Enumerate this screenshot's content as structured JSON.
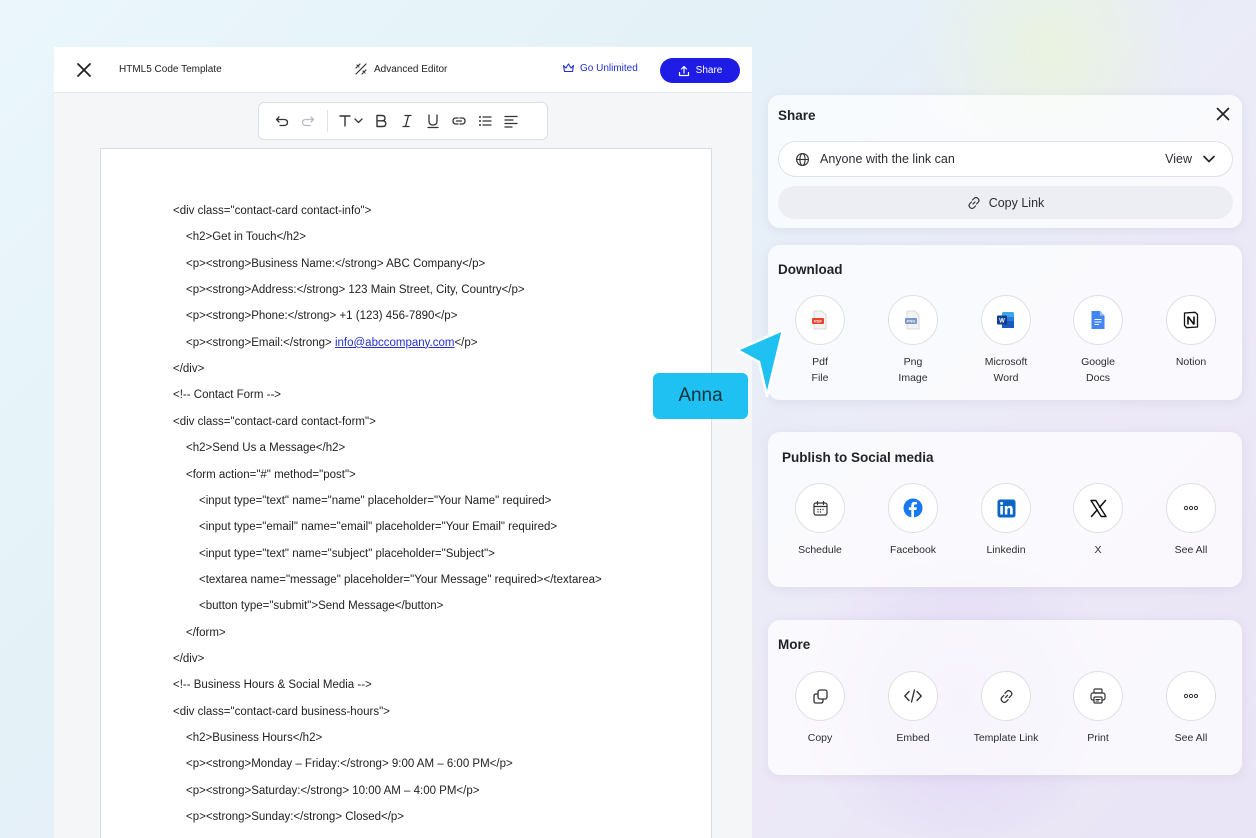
{
  "editor": {
    "doc_title": "HTML5 Code Template",
    "advanced_editor": "Advanced Editor",
    "go_unlimited": "Go Unlimited",
    "share": "Share"
  },
  "code_lines": [
    {
      "indent": 0,
      "text": "<div class=\"contact-card contact-info\">"
    },
    {
      "indent": 1,
      "text": "<h2>Get in Touch</h2>"
    },
    {
      "indent": 1,
      "text": "<p><strong>Business Name:</strong> ABC Company</p>"
    },
    {
      "indent": 1,
      "text": "<p><strong>Address:</strong> 123 Main Street, City, Country</p>"
    },
    {
      "indent": 1,
      "text": "<p><strong>Phone:</strong> +1 (123) 456-7890</p>"
    },
    {
      "indent": 1,
      "text": "<p><strong>Email:</strong> ",
      "link": "info@abccompany.com",
      "after": "</p>"
    },
    {
      "indent": 0,
      "text": "</div>"
    },
    {
      "indent": 0,
      "text": "<!-- Contact Form -->"
    },
    {
      "indent": 0,
      "text": "<div class=\"contact-card contact-form\">"
    },
    {
      "indent": 1,
      "text": "<h2>Send Us a Message</h2>"
    },
    {
      "indent": 1,
      "text": "<form action=\"#\" method=\"post\">"
    },
    {
      "indent": 2,
      "text": "<input type=\"text\" name=\"name\" placeholder=\"Your Name\" required>"
    },
    {
      "indent": 2,
      "text": "<input type=\"email\" name=\"email\" placeholder=\"Your Email\" required>"
    },
    {
      "indent": 2,
      "text": "<input type=\"text\" name=\"subject\" placeholder=\"Subject\">"
    },
    {
      "indent": 2,
      "text": "<textarea name=\"message\" placeholder=\"Your Message\" required></textarea>"
    },
    {
      "indent": 2,
      "text": "<button type=\"submit\">Send Message</button>"
    },
    {
      "indent": 1,
      "text": "</form>"
    },
    {
      "indent": 0,
      "text": "</div>"
    },
    {
      "indent": 0,
      "text": "<!-- Business Hours & Social Media -->"
    },
    {
      "indent": 0,
      "text": "<div class=\"contact-card business-hours\">"
    },
    {
      "indent": 1,
      "text": "<h2>Business Hours</h2>"
    },
    {
      "indent": 1,
      "text": "<p><strong>Monday – Friday:</strong> 9:00 AM – 6:00 PM</p>"
    },
    {
      "indent": 1,
      "text": "<p><strong>Saturday:</strong> 10:00 AM – 4:00 PM</p>"
    },
    {
      "indent": 1,
      "text": "<p><strong>Sunday:</strong> Closed</p>"
    }
  ],
  "share_panel": {
    "title": "Share",
    "access_label": "Anyone with the link can",
    "access_value": "View",
    "copy_link": "Copy Link"
  },
  "download_panel": {
    "title": "Download",
    "options": [
      {
        "line1": "Pdf",
        "line2": "File",
        "icon": "pdf-file-icon"
      },
      {
        "line1": "Png",
        "line2": "Image",
        "icon": "png-image-icon"
      },
      {
        "line1": "Microsoft",
        "line2": "Word",
        "icon": "microsoft-word-icon"
      },
      {
        "line1": "Google",
        "line2": "Docs",
        "icon": "google-docs-icon"
      },
      {
        "line1": "Notion",
        "line2": "",
        "icon": "notion-icon"
      }
    ]
  },
  "social_panel": {
    "title": "Publish to Social media",
    "options": [
      {
        "label": "Schedule",
        "icon": "calendar-icon"
      },
      {
        "label": "Facebook",
        "icon": "facebook-icon"
      },
      {
        "label": "Linkedin",
        "icon": "linkedin-icon"
      },
      {
        "label": "X",
        "icon": "x-logo-icon"
      },
      {
        "label": "See All",
        "icon": "more-dots-icon"
      }
    ]
  },
  "more_panel": {
    "title": "More",
    "options": [
      {
        "label": "Copy",
        "icon": "copy-icon"
      },
      {
        "label": "Embed",
        "icon": "embed-code-icon"
      },
      {
        "label": "Template Link",
        "icon": "link-icon"
      },
      {
        "label": "Print",
        "icon": "printer-icon"
      },
      {
        "label": "See All",
        "icon": "more-dots-icon"
      }
    ]
  },
  "collaborator": {
    "name": "Anna",
    "color": "#1ec1f1"
  },
  "colors": {
    "accent": "#1f1ce6",
    "link": "#2430d6"
  }
}
